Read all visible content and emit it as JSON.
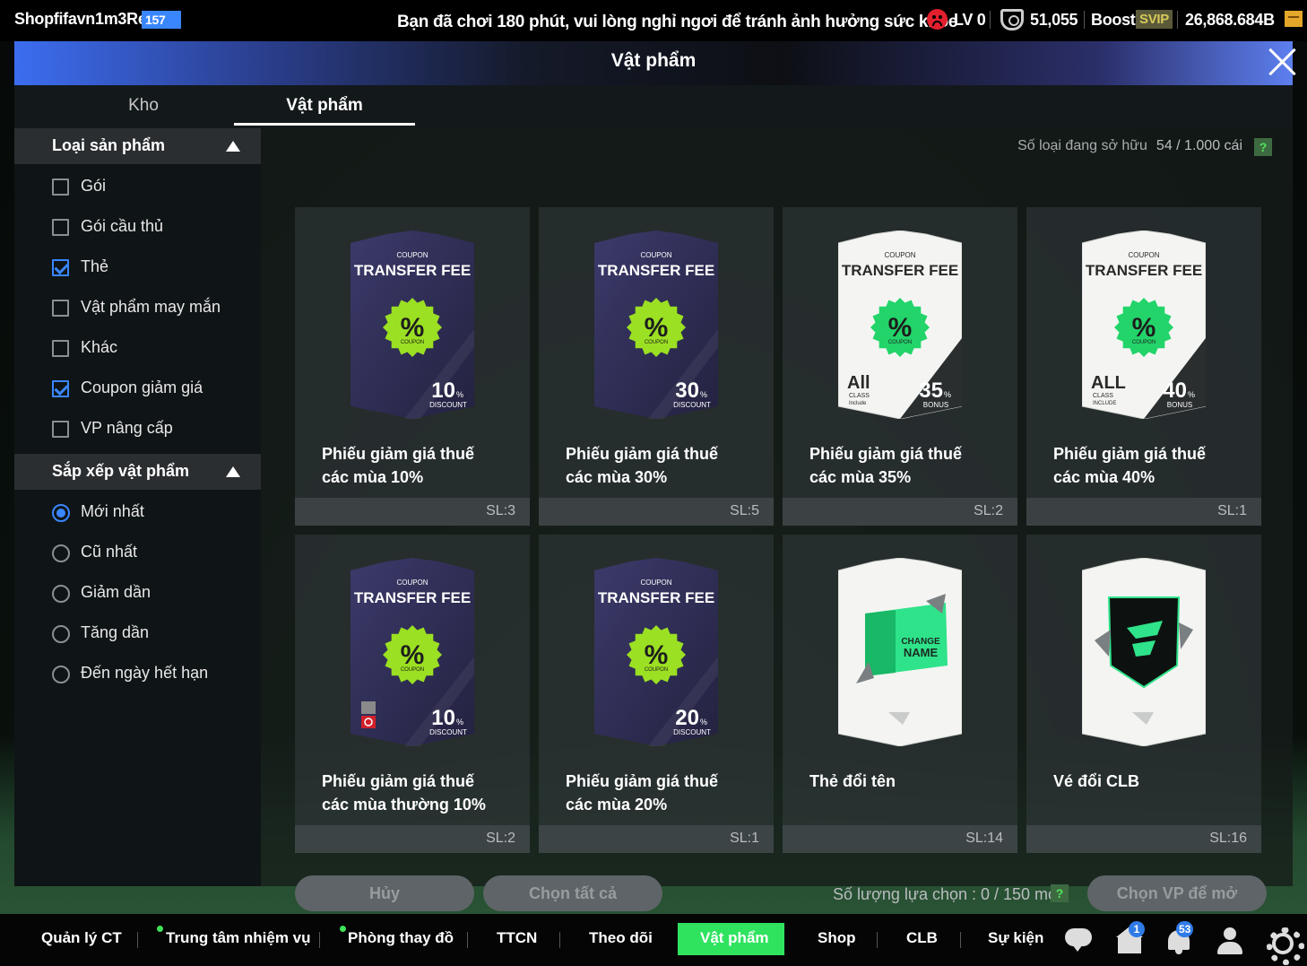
{
  "topbar": {
    "username": "Shopfifavn1m3Re",
    "user_level": "157",
    "notice": "Bạn đã chơi 180 phút, vui lòng nghỉ ngơi để tránh ảnh hưởng sức khỏe",
    "lv": "LV 0",
    "coins": "51,055",
    "boost_label": "Boost",
    "svip_label": "SVIP",
    "bp": "26,868.684B"
  },
  "modal": {
    "title": "Vật phẩm",
    "tabs": [
      "Kho",
      "Vật phẩm"
    ]
  },
  "sidebar": {
    "product_type_title": "Loại sản phẩm",
    "product_types": [
      {
        "label": "Gói",
        "checked": false
      },
      {
        "label": "Gói cầu thủ",
        "checked": false
      },
      {
        "label": "Thẻ",
        "checked": true
      },
      {
        "label": "Vật phẩm may mắn",
        "checked": false
      },
      {
        "label": "Khác",
        "checked": false
      },
      {
        "label": "Coupon giảm giá",
        "checked": true
      },
      {
        "label": "VP nâng cấp",
        "checked": false
      }
    ],
    "sort_title": "Sắp xếp vật phẩm",
    "sort_options": [
      {
        "label": "Mới nhất",
        "selected": true
      },
      {
        "label": "Cũ nhất",
        "selected": false
      },
      {
        "label": "Giảm dần",
        "selected": false
      },
      {
        "label": "Tăng dần",
        "selected": false
      },
      {
        "label": "Đến ngày hết hạn",
        "selected": false
      }
    ]
  },
  "main": {
    "owned_label": "Số loại đang sở hữu",
    "owned_value": "54 / 1.000 cái",
    "help": "?",
    "selection_label": "Số lượng lựa chọn : 0 / 150 món",
    "buttons": {
      "cancel": "Hủy",
      "select_all": "Chọn tất cả",
      "choose_open": "Chọn VP để mở"
    }
  },
  "items": [
    {
      "name": "Phiếu giảm giá thuế các mùa 10%",
      "qty": "SL:3",
      "art": {
        "kind": "coupon-dark",
        "coupon": "COUPON",
        "title": "TRANSFER FEE",
        "pct": "10",
        "pct_unit": "%",
        "sub": "DISCOUNT",
        "stamp": "COUPON"
      }
    },
    {
      "name": "Phiếu giảm giá thuế các mùa 30%",
      "qty": "SL:5",
      "art": {
        "kind": "coupon-dark",
        "coupon": "COUPON",
        "title": "TRANSFER FEE",
        "pct": "30",
        "pct_unit": "%",
        "sub": "DISCOUNT",
        "stamp": "COUPON"
      }
    },
    {
      "name": "Phiếu giảm giá thuế các mùa 35%",
      "qty": "SL:2",
      "art": {
        "kind": "coupon-light",
        "coupon": "COUPON",
        "title": "TRANSFER FEE",
        "pct": "35",
        "pct_unit": "%",
        "sub": "BONUS",
        "stamp": "COUPON",
        "all": "All",
        "class": "CLASS",
        "include": "Include"
      }
    },
    {
      "name": "Phiếu giảm giá thuế các mùa 40%",
      "qty": "SL:1",
      "art": {
        "kind": "coupon-light",
        "coupon": "COUPON",
        "title": "TRANSFER FEE",
        "pct": "40",
        "pct_unit": "%",
        "sub": "BONUS",
        "stamp": "COUPON",
        "all": "ALL",
        "class": "CLASS",
        "include": "INCLUDE"
      }
    },
    {
      "name": "Phiếu giảm giá thuế các mùa thường 10%",
      "qty": "SL:2",
      "art": {
        "kind": "coupon-dark",
        "coupon": "COUPON",
        "title": "TRANSFER FEE",
        "pct": "10",
        "pct_unit": "%",
        "sub": "DISCOUNT",
        "stamp": "COUPON",
        "restricted": true
      }
    },
    {
      "name": "Phiếu giảm giá thuế các mùa 20%",
      "qty": "SL:1",
      "art": {
        "kind": "coupon-dark",
        "coupon": "COUPON",
        "title": "TRANSFER FEE",
        "pct": "20",
        "pct_unit": "%",
        "sub": "DISCOUNT",
        "stamp": "COUPON"
      }
    },
    {
      "name": "Thẻ đổi tên",
      "qty": "SL:14",
      "art": {
        "kind": "rename",
        "text1": "CHANGE",
        "text2": "NAME"
      }
    },
    {
      "name": "Vé đổi CLB",
      "qty": "SL:16",
      "art": {
        "kind": "club"
      }
    }
  ],
  "bottom_nav": {
    "items": [
      "Quản lý CT",
      "Trung tâm nhiệm vụ",
      "Phòng thay đồ",
      "TTCN",
      "Theo dõi",
      "Vật phẩm",
      "Shop",
      "CLB",
      "Sự kiện"
    ],
    "active": "Vật phẩm",
    "home_badge": "1",
    "bell_badge": "53"
  },
  "colors": {
    "accent_green": "#2fe35f",
    "accent_blue": "#3a86ff",
    "coupon_green": "#9be022"
  },
  "icons": [
    "sad-face-icon",
    "shield-icon",
    "gem-icon",
    "close-icon",
    "triangle-up-icon",
    "help-icon",
    "chat-icon",
    "home-icon",
    "bell-icon",
    "user-icon",
    "gear-icon"
  ]
}
